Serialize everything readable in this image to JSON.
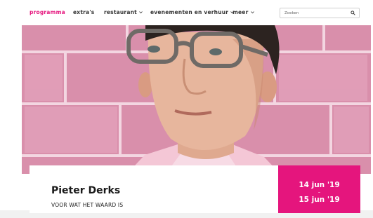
{
  "nav": {
    "items": [
      {
        "label": "programma",
        "active": true,
        "dropdown": false
      },
      {
        "label": "extra's",
        "active": false,
        "dropdown": false
      },
      {
        "label": "restaurant",
        "active": false,
        "dropdown": true
      },
      {
        "label": "evenementen en verhuur",
        "active": false,
        "dropdown": true
      },
      {
        "label": "meer",
        "active": false,
        "dropdown": true
      }
    ],
    "search_placeholder": "Zoeken"
  },
  "event": {
    "name": "Pieter Derks",
    "title": "VOOR WAT HET WAARD IS",
    "date_start": "14 jun '19",
    "date_separator": "–",
    "date_end": "15 jun '19"
  },
  "colors": {
    "accent": "#e5157d",
    "text": "#1a1a1a",
    "tile_pink": "#d98fab"
  }
}
